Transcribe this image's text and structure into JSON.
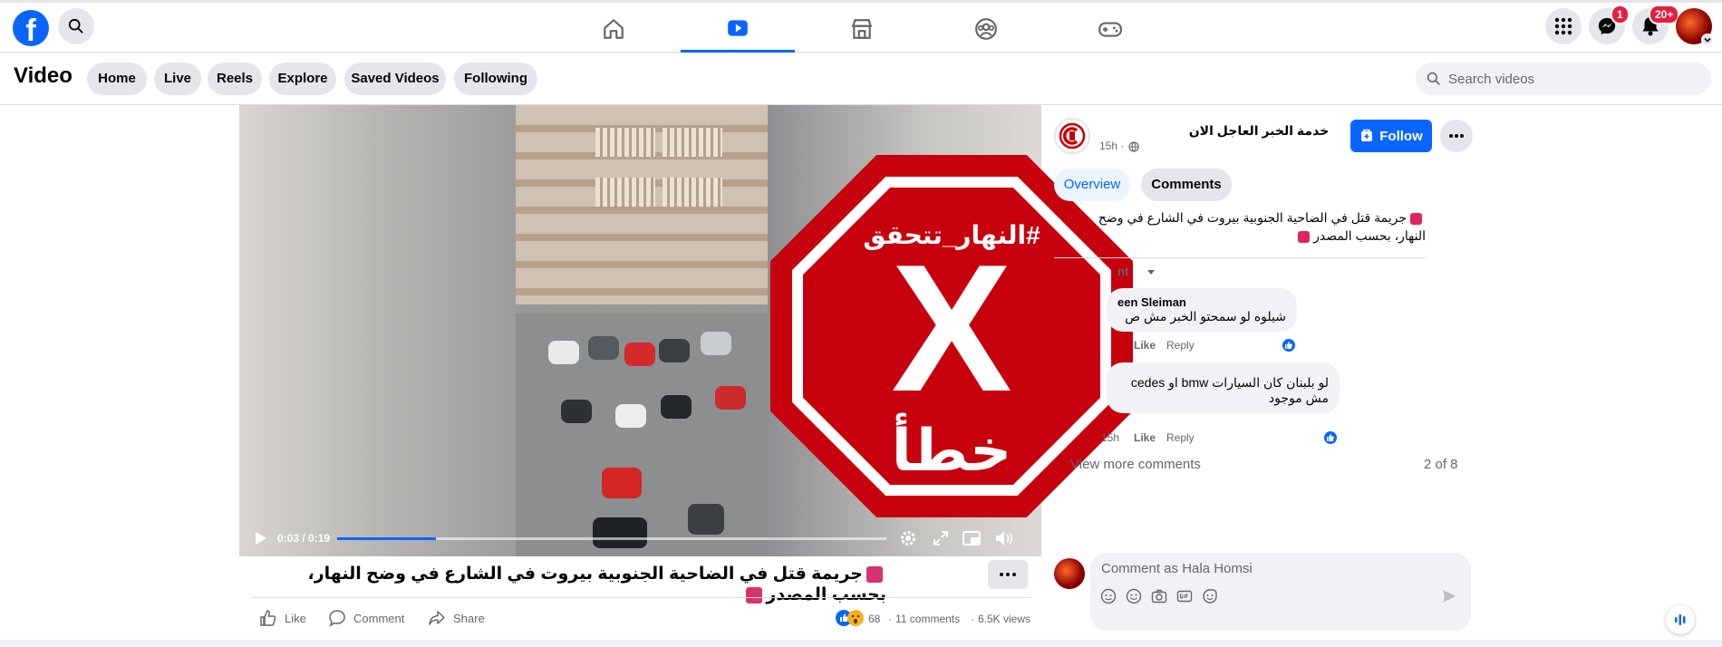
{
  "topbar": {
    "logo_letter": "f",
    "badges": {
      "messenger": "1",
      "notifications": "20+"
    }
  },
  "subbar": {
    "title": "Video",
    "tabs": [
      "Home",
      "Live",
      "Reels",
      "Explore",
      "Saved Videos",
      "Following"
    ],
    "search_placeholder": "Search videos"
  },
  "video": {
    "overlay": {
      "hashtag": "#النهار_تتحقق",
      "mark": "X",
      "verdict": "خطأ"
    },
    "time": "0:03 / 0:19",
    "progress": 0.18,
    "title": "جريمة قتل في الضاحية الجنوبية بيروت في الشارع في وضح النهار، بحسب المصدر",
    "actions": {
      "like": "Like",
      "comment": "Comment",
      "share": "Share"
    },
    "reactions_count": "68",
    "comments_count": "11 comments",
    "views": "6.5K views"
  },
  "sidebar": {
    "channel_name": "خدمة الخبر العاجل الان",
    "time_ago": "15h ·",
    "follow_label": "Follow",
    "tabs": [
      "Overview",
      "Comments"
    ],
    "description": "جريمة قتل في الضاحية الجنوبية بيروت في الشارع في وضح النهار، بحسب المصدر",
    "sort_label": "nt",
    "comments": [
      {
        "author": "een Sleiman",
        "text": "شيلوه لو سمحتو الخبر مش ص",
        "time": "",
        "like": "Like",
        "reply": "Reply"
      },
      {
        "author": "",
        "text_line1": "لو بلبنان كان السيارات bmw او cedes",
        "text_line2": "مش موجود",
        "time": "15h",
        "like": "Like",
        "reply": "Reply"
      }
    ],
    "view_more": "View more comments",
    "pagination": "2 of 8",
    "compose_placeholder": "Comment as Hala Homsi"
  },
  "colors": {
    "accent": "#0866ff",
    "stop_red": "#c7000d",
    "badge_red": "#e41e3f"
  }
}
